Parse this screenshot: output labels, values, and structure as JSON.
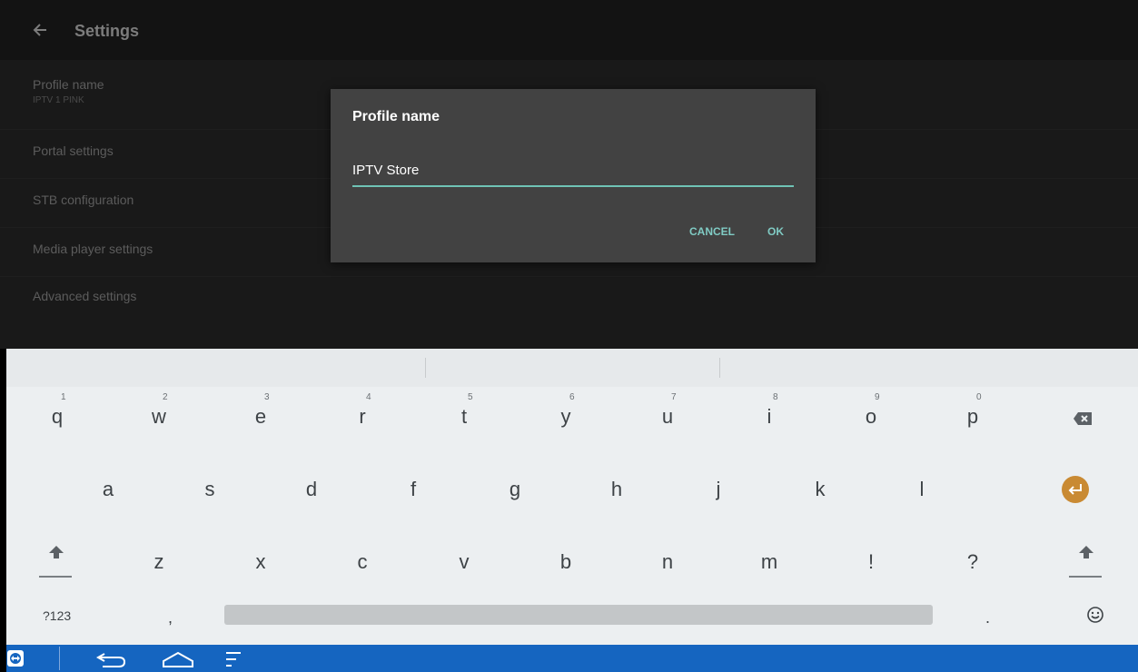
{
  "app_bar": {
    "title": "Settings",
    "back_icon": "arrow-left-icon"
  },
  "settings_list": [
    {
      "title": "Profile name",
      "subtitle": "IPTV 1 PINK"
    },
    {
      "title": "Portal settings"
    },
    {
      "title": "STB configuration"
    },
    {
      "title": "Media player settings"
    },
    {
      "title": "Advanced settings"
    }
  ],
  "dialog": {
    "title": "Profile name",
    "input_value": "IPTV Store",
    "cancel_label": "CANCEL",
    "ok_label": "OK",
    "accent_color": "#80cbc4"
  },
  "keyboard": {
    "row1": [
      {
        "label": "q",
        "num": "1"
      },
      {
        "label": "w",
        "num": "2"
      },
      {
        "label": "e",
        "num": "3"
      },
      {
        "label": "r",
        "num": "4"
      },
      {
        "label": "t",
        "num": "5"
      },
      {
        "label": "y",
        "num": "6"
      },
      {
        "label": "u",
        "num": "7"
      },
      {
        "label": "i",
        "num": "8"
      },
      {
        "label": "o",
        "num": "9"
      },
      {
        "label": "p",
        "num": "0"
      }
    ],
    "row2": [
      "a",
      "s",
      "d",
      "f",
      "g",
      "h",
      "j",
      "k",
      "l"
    ],
    "row3": [
      "z",
      "x",
      "c",
      "v",
      "b",
      "n",
      "m",
      "!",
      "?"
    ],
    "symbols_label": "?123",
    "comma_label": ",",
    "period_label": ".",
    "icons": {
      "backspace": "backspace-icon",
      "enter": "enter-icon",
      "shift": "shift-icon",
      "emoji": "emoji-icon"
    },
    "enter_color": "#c98a33"
  },
  "nav_bar": {
    "color": "#1565c0",
    "icons": [
      "teamviewer-icon",
      "back-icon",
      "home-icon",
      "menu-icon"
    ]
  }
}
